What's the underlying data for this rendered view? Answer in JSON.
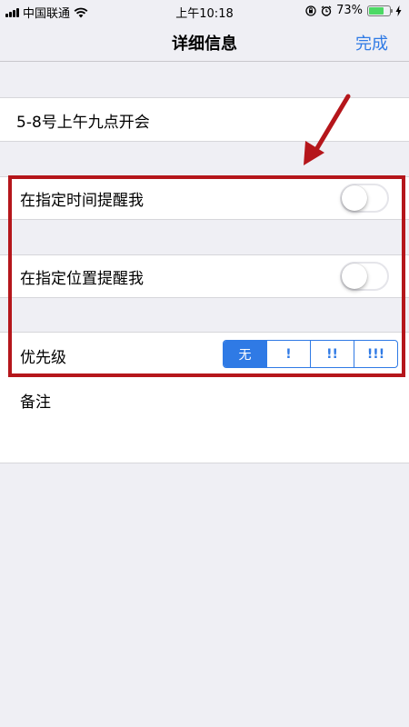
{
  "status_bar": {
    "carrier": "中国联通",
    "time": "上午10:18",
    "battery_percent": "73%",
    "battery_level": 0.73,
    "icons": [
      "signal-icon",
      "wifi-icon",
      "rotation-lock-icon",
      "alarm-icon",
      "battery-icon",
      "charging-icon"
    ]
  },
  "nav": {
    "title": "详细信息",
    "done_label": "完成"
  },
  "reminder": {
    "title": "5-8号上午九点开会"
  },
  "remind_time": {
    "label": "在指定时间提醒我",
    "enabled": false
  },
  "remind_location": {
    "label": "在指定位置提醒我",
    "enabled": false
  },
  "priority": {
    "label": "优先级",
    "options": [
      "无",
      "!",
      "!!",
      "!!!"
    ],
    "selected": "无"
  },
  "notes": {
    "label": "备注"
  },
  "colors": {
    "accent": "#2f7ae5",
    "annotation": "#b5161b",
    "background": "#efeff4"
  }
}
